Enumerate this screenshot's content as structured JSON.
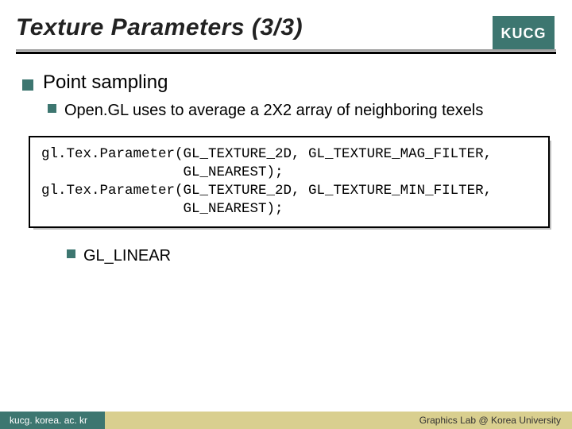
{
  "header": {
    "title": "Texture Parameters (3/3)",
    "logo_text": "KUCG"
  },
  "content": {
    "lvl1": "Point sampling",
    "lvl2a": "Open.GL uses to average a 2X2 array of neighboring texels",
    "code_text": "gl.Tex.Parameter(GL_TEXTURE_2D, GL_TEXTURE_MAG_FILTER,\n                 GL_NEAREST);\ngl.Tex.Parameter(GL_TEXTURE_2D, GL_TEXTURE_MIN_FILTER,\n                 GL_NEAREST);",
    "lvl2b": "GL_LINEAR"
  },
  "footer": {
    "left": "kucg. korea. ac. kr",
    "right": "Graphics Lab @ Korea University"
  }
}
